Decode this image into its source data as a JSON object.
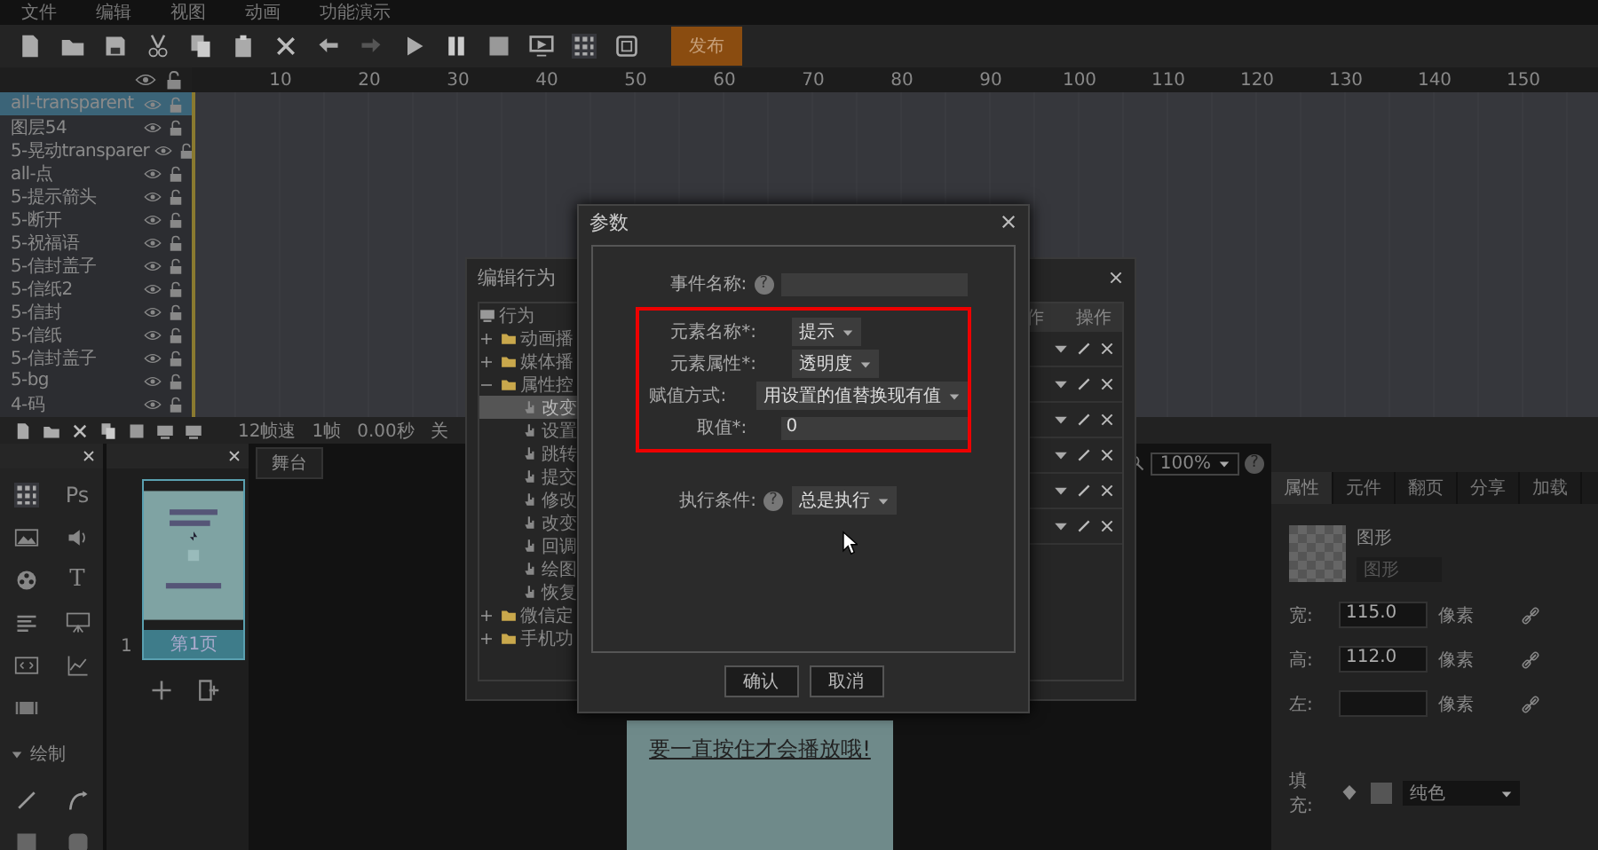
{
  "menu": [
    "文件",
    "编辑",
    "视图",
    "动画",
    "功能演示"
  ],
  "toolbar": {
    "publish_button": "发布"
  },
  "layers": {
    "rows": [
      {
        "name": "all-transparent",
        "selected": true
      },
      {
        "name": "图层54",
        "selected": false
      },
      {
        "name": "5-晃动transparer",
        "selected": false
      },
      {
        "name": "all-点",
        "selected": false
      },
      {
        "name": "5-提示箭头",
        "selected": false
      },
      {
        "name": "5-断开",
        "selected": false
      },
      {
        "name": "5-祝福语",
        "selected": false
      },
      {
        "name": "5-信封盖子",
        "selected": false
      },
      {
        "name": "5-信纸2",
        "selected": false
      },
      {
        "name": "5-信封",
        "selected": false
      },
      {
        "name": "5-信纸",
        "selected": false
      },
      {
        "name": "5-信封盖子",
        "selected": false
      },
      {
        "name": "5-bg",
        "selected": false
      },
      {
        "name": "4-码",
        "selected": false
      }
    ]
  },
  "ruler": {
    "ticks": [
      "10",
      "20",
      "30",
      "40",
      "50",
      "60",
      "70",
      "80",
      "90",
      "100",
      "110",
      "120",
      "130",
      "140",
      "150"
    ]
  },
  "timeline_status": {
    "frame_rate": "12帧速",
    "frame": "1帧",
    "time": "0.00秒",
    "column_4": "关"
  },
  "tools_panel": {
    "text_tools": [
      "Ps",
      "T"
    ],
    "section": "绘制",
    "section_expanded": true
  },
  "pages": [
    {
      "number": "1",
      "label": "第1页",
      "selected": true
    }
  ],
  "stage": {
    "tab": "舞台",
    "zoom": "100%",
    "help_icon": "?",
    "caption": "要一直按住才会播放哦!"
  },
  "properties": {
    "tabs": [
      {
        "label": "属性",
        "selected": true
      },
      {
        "label": "元件",
        "selected": false
      },
      {
        "label": "翻页",
        "selected": false
      },
      {
        "label": "分享",
        "selected": false
      },
      {
        "label": "加载",
        "selected": false
      }
    ],
    "element_type": "图形",
    "name_value": "图形",
    "fields": [
      {
        "label": "宽:",
        "value": "115.0",
        "unit": "像素"
      },
      {
        "label": "高:",
        "value": "112.0",
        "unit": "像素"
      },
      {
        "label": "左:",
        "unit": "像素"
      }
    ],
    "fill": {
      "label": "填充:",
      "value": "纯色"
    }
  },
  "behavior_dialog": {
    "title": "编辑行为",
    "root": "行为",
    "tree": [
      {
        "label": "动画播",
        "expanded": false
      },
      {
        "label": "媒体播",
        "expanded": false
      },
      {
        "label": "属性控",
        "expanded": true,
        "children": [
          {
            "label": "改变",
            "selected": true
          },
          {
            "label": "设置",
            "selected": false
          },
          {
            "label": "跳转",
            "selected": false
          },
          {
            "label": "提交",
            "selected": false
          },
          {
            "label": "修改",
            "selected": false
          },
          {
            "label": "改变",
            "selected": false
          },
          {
            "label": "回调",
            "selected": false
          },
          {
            "label": "绘图",
            "selected": false
          },
          {
            "label": "恢复",
            "selected": false
          }
        ]
      },
      {
        "label": "微信定",
        "expanded": false
      },
      {
        "label": "手机功",
        "expanded": false
      }
    ],
    "columns": [
      "作",
      "操作"
    ],
    "rows": [
      {
        "kind": "action"
      },
      {
        "kind": "action"
      },
      {
        "kind": "action"
      },
      {
        "kind": "action"
      },
      {
        "kind": "action"
      },
      {
        "kind": "action"
      }
    ]
  },
  "param_dialog": {
    "title": "参数",
    "groups": [
      {
        "highlighted": false,
        "rows": [
          {
            "label": "事件名称:",
            "help_icon": "?",
            "kind": "text"
          }
        ]
      },
      {
        "highlighted": true,
        "rows": [
          {
            "label": "元素名称*:",
            "kind": "select",
            "value": "提示"
          },
          {
            "label": "元素属性*:",
            "kind": "select",
            "value": "透明度"
          },
          {
            "label": "赋值方式:",
            "kind": "select",
            "value": "用设置的值替换现有值"
          },
          {
            "label": "取值*:",
            "kind": "text",
            "value": "0"
          }
        ]
      },
      {
        "highlighted": false,
        "rows": [
          {
            "label": "执行条件:",
            "help_icon": "?",
            "kind": "select",
            "value": "总是执行"
          }
        ]
      }
    ],
    "buttons": [
      "确认",
      "取消"
    ]
  }
}
